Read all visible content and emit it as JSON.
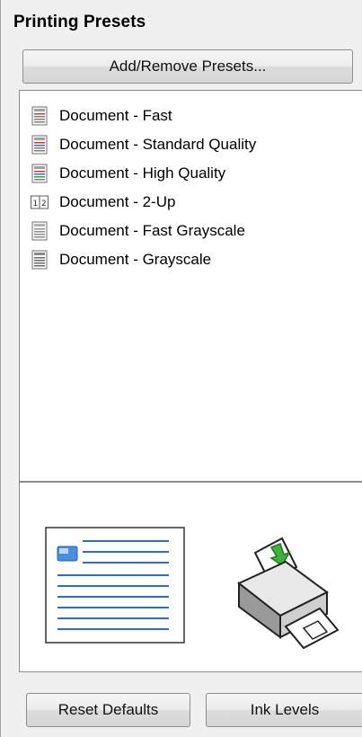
{
  "panel": {
    "title": "Printing Presets",
    "add_remove_label": "Add/Remove Presets..."
  },
  "presets": [
    {
      "label": "Document - Fast",
      "icon": "document-fast-icon"
    },
    {
      "label": "Document - Standard Quality",
      "icon": "document-standard-icon"
    },
    {
      "label": "Document - High Quality",
      "icon": "document-high-quality-icon"
    },
    {
      "label": "Document - 2-Up",
      "icon": "two-up-icon",
      "icon_text": "1 2"
    },
    {
      "label": "Document - Fast Grayscale",
      "icon": "document-grayscale-fast-icon"
    },
    {
      "label": "Document - Grayscale",
      "icon": "document-grayscale-icon"
    }
  ],
  "preview": {
    "paper_icon": "document-preview-icon",
    "printer_icon": "printer-feed-icon"
  },
  "footer": {
    "reset_label": "Reset Defaults",
    "ink_label": "Ink Levels"
  },
  "colors": {
    "accent_blue": "#2b6fd6",
    "printer_arrow_green": "#3cb43c"
  }
}
